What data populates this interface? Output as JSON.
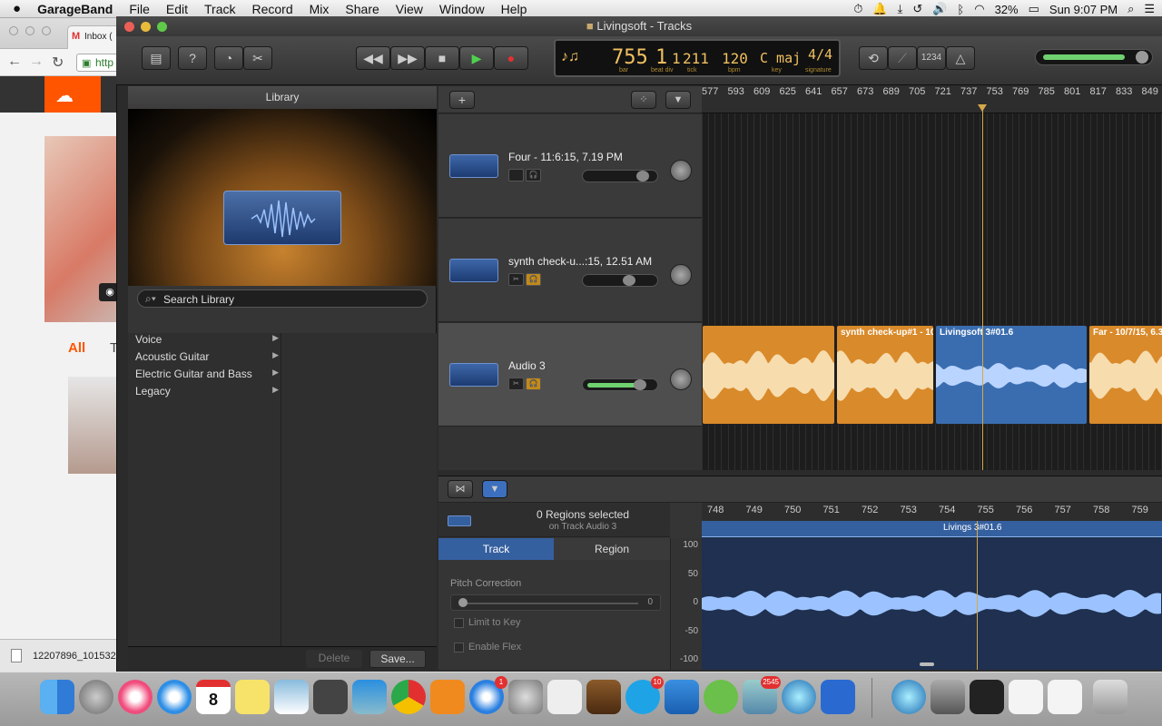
{
  "menubar": {
    "apple": "",
    "app_name": "GarageBand",
    "items": [
      "File",
      "Edit",
      "Track",
      "Record",
      "Mix",
      "Share",
      "View",
      "Window",
      "Help"
    ],
    "battery": "32%",
    "clock": "Sun 9:07 PM"
  },
  "chrome": {
    "tab_title": "Inbox (",
    "url_text": "http",
    "section_all": "All",
    "section_t": "T",
    "download_file": "12207896_101532"
  },
  "window": {
    "title": "Livingsoft  - Tracks"
  },
  "lcd": {
    "bar": "755",
    "beat": "1",
    "div": "1",
    "tick": "211",
    "bpm": "120",
    "key": "C maj",
    "signature": "4/4",
    "labels": {
      "bar": "bar",
      "beat_div": "beat div",
      "tick": "tick",
      "bpm": "bpm",
      "key": "key",
      "signature": "signature"
    },
    "meter_fraction": 0.82
  },
  "toolbar": {
    "counter": "1234",
    "help": "?"
  },
  "library": {
    "title": "Library",
    "search_placeholder": "Search Library",
    "items": [
      "Voice",
      "Acoustic Guitar",
      "Electric Guitar and Bass",
      "Legacy"
    ],
    "delete_label": "Delete",
    "save_label": "Save..."
  },
  "tracks": [
    {
      "name": "Four - 11:6:15, 7.19 PM",
      "volume": 0.8,
      "selected": false
    },
    {
      "name": "synth check-u...:15, 12.51 AM",
      "volume": 0.6,
      "selected": false
    },
    {
      "name": "Audio 3",
      "volume": 0.75,
      "selected": true
    }
  ],
  "ruler": [
    "577",
    "593",
    "609",
    "625",
    "641",
    "657",
    "673",
    "689",
    "705",
    "721",
    "737",
    "753",
    "769",
    "785",
    "801",
    "817",
    "833",
    "849"
  ],
  "regions": [
    {
      "name": "",
      "color": "#d98a2a"
    },
    {
      "name": "synth check-up#1 - 10",
      "color": "#d98a2a"
    },
    {
      "name": "Livingsoft  3#01.6",
      "color": "#3a6db0"
    },
    {
      "name": "Far - 10/7/15, 6.3",
      "color": "#d98a2a"
    }
  ],
  "editor": {
    "regions_selected": "0 Regions selected",
    "on_track": "on Track Audio 3",
    "tab_track": "Track",
    "tab_region": "Region",
    "pitch_correction": "Pitch Correction",
    "pitch_value": "0",
    "limit_to_key": "Limit to Key",
    "enable_flex": "Enable Flex",
    "scale": [
      "100",
      "50",
      "0",
      "-50",
      "-100"
    ],
    "ruler": [
      "748",
      "749",
      "750",
      "751",
      "752",
      "753",
      "754",
      "755",
      "756",
      "757",
      "758",
      "759"
    ],
    "region_name": "Livings   3#01.6"
  },
  "dock": {
    "calendar_day": "8",
    "badges": {
      "appstore": "1",
      "skype": "10",
      "mail": "2545"
    }
  }
}
